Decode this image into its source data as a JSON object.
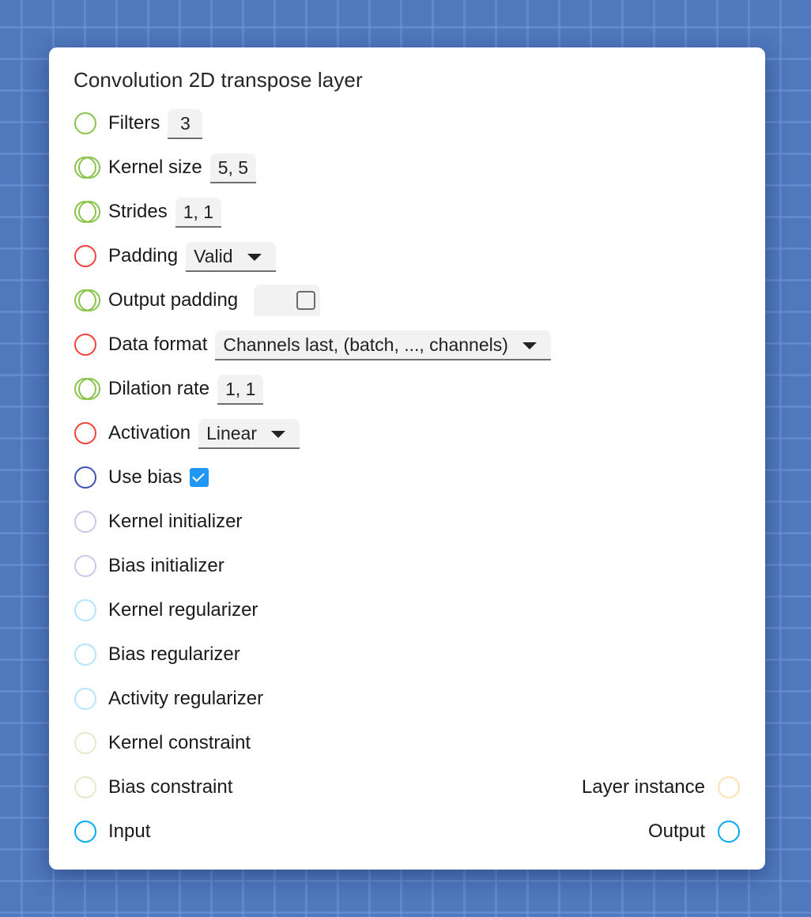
{
  "node": {
    "title": "Convolution 2D transpose layer",
    "colors": {
      "green": "#8bc34a",
      "red": "#f44336",
      "indigo": "#3f51b5",
      "lavender": "#c5cae9",
      "lightblue": "#b3e5fc",
      "lightgreen": "#dcedc8",
      "orange": "#ffe0b2",
      "blue": "#03a9f4",
      "checkbox": "#2196f3"
    },
    "params": [
      {
        "label": "Filters",
        "type": "number",
        "value": "3",
        "socket": "single",
        "color": "green"
      },
      {
        "label": "Kernel size",
        "type": "text",
        "value": "5, 5",
        "socket": "double",
        "color": "green"
      },
      {
        "label": "Strides",
        "type": "text",
        "value": "1, 1",
        "socket": "double",
        "color": "green"
      },
      {
        "label": "Padding",
        "type": "select",
        "value": "Valid",
        "socket": "single",
        "color": "red"
      },
      {
        "label": "Output padding",
        "type": "optional-checkbox",
        "checked": false,
        "socket": "double",
        "color": "green"
      },
      {
        "label": "Data format",
        "type": "select",
        "value": "Channels last, (batch, ..., channels)",
        "socket": "single",
        "color": "red"
      },
      {
        "label": "Dilation rate",
        "type": "text",
        "value": "1, 1",
        "socket": "double",
        "color": "green"
      },
      {
        "label": "Activation",
        "type": "select",
        "value": "Linear",
        "socket": "single",
        "color": "red"
      },
      {
        "label": "Use bias",
        "type": "checkbox",
        "checked": true,
        "socket": "single",
        "color": "indigo"
      },
      {
        "label": "Kernel initializer",
        "socket": "single",
        "color": "lavender"
      },
      {
        "label": "Bias initializer",
        "socket": "single",
        "color": "lavender"
      },
      {
        "label": "Kernel regularizer",
        "socket": "single",
        "color": "lightblue"
      },
      {
        "label": "Bias regularizer",
        "socket": "single",
        "color": "lightblue"
      },
      {
        "label": "Activity regularizer",
        "socket": "single",
        "color": "lightblue"
      },
      {
        "label": "Kernel constraint",
        "socket": "single",
        "color": "lightgreen"
      },
      {
        "label": "Bias constraint",
        "socket": "single",
        "color": "lightgreen"
      },
      {
        "label": "Input",
        "socket": "single",
        "color": "blue"
      }
    ],
    "outputs": [
      {
        "label": "Layer instance",
        "color": "orange"
      },
      {
        "label": "Output",
        "color": "blue"
      }
    ]
  }
}
